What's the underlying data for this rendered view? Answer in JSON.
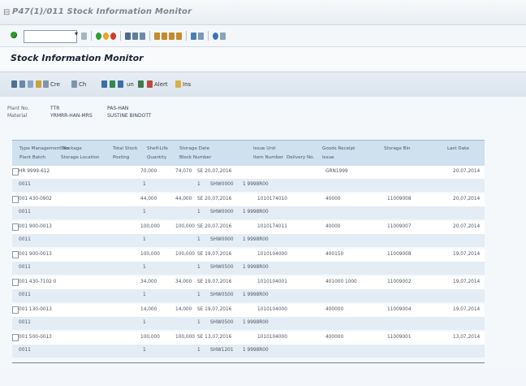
{
  "window": {
    "title": "P47(1)/011 Stock Information Monitor",
    "icon": "window-menu-icon"
  },
  "toolbar": {
    "command_value": "",
    "icon_names": [
      "ok-icon",
      "save-icon",
      "back-icon",
      "exit-icon",
      "cancel-icon",
      "print-icon",
      "find-icon",
      "first-page-icon",
      "next-page-icon",
      "create-session-icon",
      "layout-icon",
      "help-icon"
    ]
  },
  "panel": {
    "title": "Stock Information Monitor"
  },
  "app_toolbar": {
    "buttons": [
      {
        "label": "",
        "icon": "select-all-icon"
      },
      {
        "label": "",
        "icon": "deselect-icon"
      },
      {
        "label": "",
        "icon": "filter-icon"
      },
      {
        "label": "Cre",
        "icon": "create-icon"
      },
      {
        "label": "Ch",
        "icon": "change-icon"
      },
      {
        "label": "",
        "icon": "sort-icon"
      },
      {
        "label": "",
        "icon": "export-icon"
      },
      {
        "label": "un",
        "icon": "unit-icon"
      },
      {
        "label": "",
        "icon": "summary-icon"
      },
      {
        "label": "Alert",
        "icon": "alert-icon"
      },
      {
        "label": "Ins",
        "icon": "info-icon"
      }
    ]
  },
  "header_fields": [
    {
      "label": "Plant No.",
      "value": "TTR",
      "value2": "PAS-HAN"
    },
    {
      "label": "Material",
      "value": "YRMRR-HAN-MRS",
      "value2": "SUSTINE BINDOTT"
    }
  ],
  "table": {
    "header_line1": [
      "Type Management No.",
      "Stockage",
      "Total Stock",
      "Shelf-Life",
      "Storage Date",
      "Issue Unit",
      "Goods Receipt",
      "Storage Bin",
      "Last Date"
    ],
    "header_line2": [
      "Plant Batch",
      "Storage Location",
      "Posting",
      "Quantity",
      "Block Number",
      "Item Number",
      "Delivery No.",
      "Issue",
      "",
      "",
      ""
    ],
    "rows": [
      {
        "c1": "HR 9999-612",
        "c2": "",
        "c3": "70,000",
        "c4": "74,070",
        "c5": "SE  20,07,2016",
        "c6": "",
        "c7": "GRN1999",
        "c8": "",
        "c9": "20,07,2014",
        "r2a": "0011",
        "r2b": "1",
        "r2c": "1",
        "r2d": "SHW0000",
        "r2e": "1 9998R00"
      },
      {
        "c1": "001 430-0902",
        "c2": "",
        "c3": "44,000",
        "c4": "44,000",
        "c5": "SE  20,07,2016",
        "c6": "1010174010",
        "c7": "40000",
        "c8": "11009008",
        "c9": "20,07,2014",
        "r2a": "0011",
        "r2b": "1",
        "r2c": "1",
        "r2d": "SHW0000",
        "r2e": "1 9998R00"
      },
      {
        "c1": "001 900-0013",
        "c2": "",
        "c3": "100,000",
        "c4": "100,000",
        "c5": "SE  20,07,2016",
        "c6": "1010174011",
        "c7": "40000",
        "c8": "11009007",
        "c9": "20,07,2014",
        "r2a": "0011",
        "r2b": "1",
        "r2c": "1",
        "r2d": "SHW0000",
        "r2e": "1 9998R00"
      },
      {
        "c1": "001 900-0013",
        "c2": "",
        "c3": "100,000",
        "c4": "100,000",
        "c5": "SE  19,07,2016",
        "c6": "1010104000",
        "c7": "400150",
        "c8": "11009008",
        "c9": "19,07,2014",
        "r2a": "0011",
        "r2b": "1",
        "r2c": "1",
        "r2d": "SHW0500",
        "r2e": "1 9998R00"
      },
      {
        "c1": "001 430-7102  0",
        "c2": "",
        "c3": "34,000",
        "c4": "34,000",
        "c5": "SE  19,07,2016",
        "c6": "1010104001",
        "c7": "401000 1000",
        "c8": "11009002",
        "c9": "19,07,2014",
        "r2a": "0011",
        "r2b": "1",
        "r2c": "1",
        "r2d": "SHW0500",
        "r2e": "1 9998R00"
      },
      {
        "c1": "001 130-0013",
        "c2": "",
        "c3": "14,000",
        "c4": "14,000",
        "c5": "SE  19,07,2016",
        "c6": "1010104000",
        "c7": "400000",
        "c8": "11009004",
        "c9": "19,07,2014",
        "r2a": "0011",
        "r2b": "1",
        "r2c": "1",
        "r2d": "SHW0500",
        "r2e": "1 9998R00"
      },
      {
        "c1": "001 500-0013",
        "c2": "",
        "c3": "100,000",
        "c4": "100,000",
        "c5": "SE  13,07,2016",
        "c6": "1010104000",
        "c7": "400000",
        "c8": "11009001",
        "c9": "13,07,2014",
        "r2a": "0011",
        "r2b": "1",
        "r2c": "1",
        "r2d": "SHW1201",
        "r2e": "1 9998R00"
      }
    ]
  }
}
